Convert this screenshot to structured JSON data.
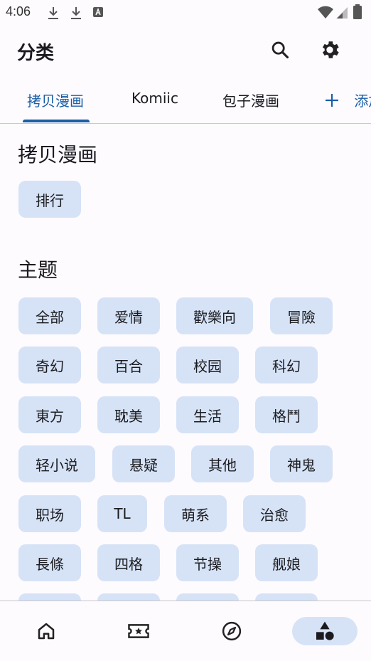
{
  "status_bar": {
    "time": "4:06",
    "icons": [
      "download-icon",
      "download-icon",
      "app-notification-icon",
      "wifi-icon",
      "cellular-icon",
      "battery-icon"
    ]
  },
  "appbar": {
    "title": "分类",
    "actions": [
      "search-icon",
      "settings-icon"
    ]
  },
  "tabs": {
    "items": [
      "拷贝漫画",
      "Komiic",
      "包子漫画"
    ],
    "active": "拷贝漫画",
    "add_label": "添加"
  },
  "sections": [
    {
      "title": "拷贝漫画",
      "chips": [
        "排行"
      ]
    },
    {
      "title": "主题",
      "chips": [
        "全部",
        "爱情",
        "歡樂向",
        "冒險",
        "奇幻",
        "百合",
        "校园",
        "科幻",
        "東方",
        "耽美",
        "生活",
        "格鬥",
        "轻小说",
        "悬疑",
        "其他",
        "神鬼",
        "职场",
        "TL",
        "萌系",
        "治愈",
        "長條",
        "四格",
        "节操",
        "舰娘"
      ]
    }
  ],
  "bottom_nav": {
    "items": [
      "home-icon",
      "ticket-icon",
      "explore-icon",
      "categories-icon"
    ],
    "active": "categories-icon"
  },
  "colors": {
    "accent": "#1a5fa6",
    "chip_bg": "#d6e3f7",
    "background": "#fefbff"
  }
}
